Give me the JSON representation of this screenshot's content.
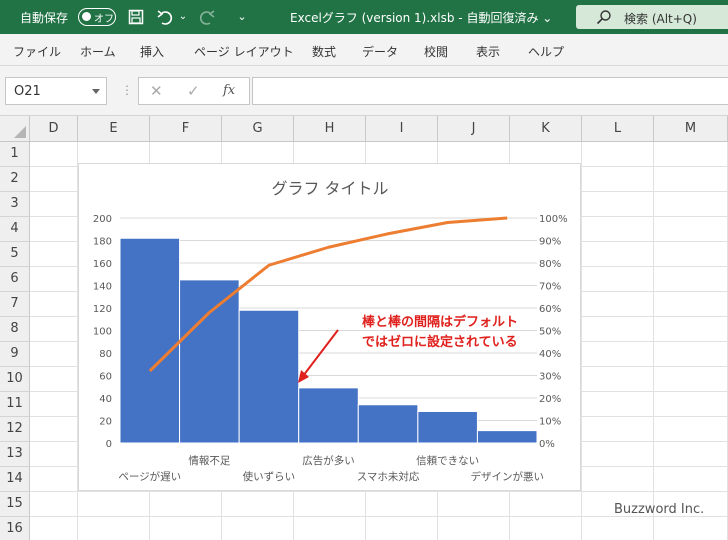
{
  "titlebar": {
    "autosave_label": "自動保存",
    "toggle_state": "オフ",
    "document_title": "Excelグラフ (version 1).xlsb  -  自動回復済み ⌄",
    "search_label": "検索 (Alt+Q)",
    "icons": [
      "save-icon",
      "undo-icon",
      "redo-icon",
      "customize-icon",
      "search-icon"
    ]
  },
  "ribbon": {
    "tabs": [
      "ファイル",
      "ホーム",
      "挿入",
      "ページ レイアウト",
      "数式",
      "データ",
      "校閲",
      "表示",
      "ヘルプ"
    ]
  },
  "formula_bar": {
    "name_box": "O21",
    "separator": "⋮",
    "cancel": "✕",
    "enter": "✓",
    "fx": "fx",
    "value": ""
  },
  "sheet": {
    "columns": [
      "D",
      "E",
      "F",
      "G",
      "H",
      "I",
      "J",
      "K",
      "L",
      "M"
    ],
    "rows": [
      "1",
      "2",
      "3",
      "4",
      "5",
      "6",
      "7",
      "8",
      "9",
      "10",
      "11",
      "12",
      "13",
      "14",
      "15",
      "16"
    ]
  },
  "chart_data": {
    "type": "bar",
    "title": "グラフ タイトル",
    "categories": [
      "ページが遅い",
      "情報不足",
      "使いずらい",
      "広告が多い",
      "スマホ未対応",
      "信頼できない",
      "デザインが悪い"
    ],
    "series": [
      {
        "values": [
          182,
          145,
          118,
          49,
          34,
          28,
          11
        ],
        "color": "#4472c4"
      },
      {
        "values": [
          32,
          58,
          79,
          87,
          93,
          98,
          100
        ],
        "color": "#ed7d31",
        "axis": "secondary"
      }
    ],
    "primary_ticks": [
      "0",
      "20",
      "40",
      "60",
      "80",
      "100",
      "120",
      "140",
      "160",
      "180",
      "200"
    ],
    "secondary_ticks": [
      "0%",
      "10%",
      "20%",
      "30%",
      "40%",
      "50%",
      "60%",
      "70%",
      "80%",
      "90%",
      "100%"
    ],
    "ylim": [
      0,
      200
    ],
    "y2lim": [
      0,
      100
    ],
    "gap_width": 0,
    "grid": true,
    "annotation": {
      "text_line1": "棒と棒の間隔はデフォルト",
      "text_line2": "ではゼロに設定されている",
      "color": "#e0201c"
    }
  },
  "watermark": "Buzzword Inc."
}
